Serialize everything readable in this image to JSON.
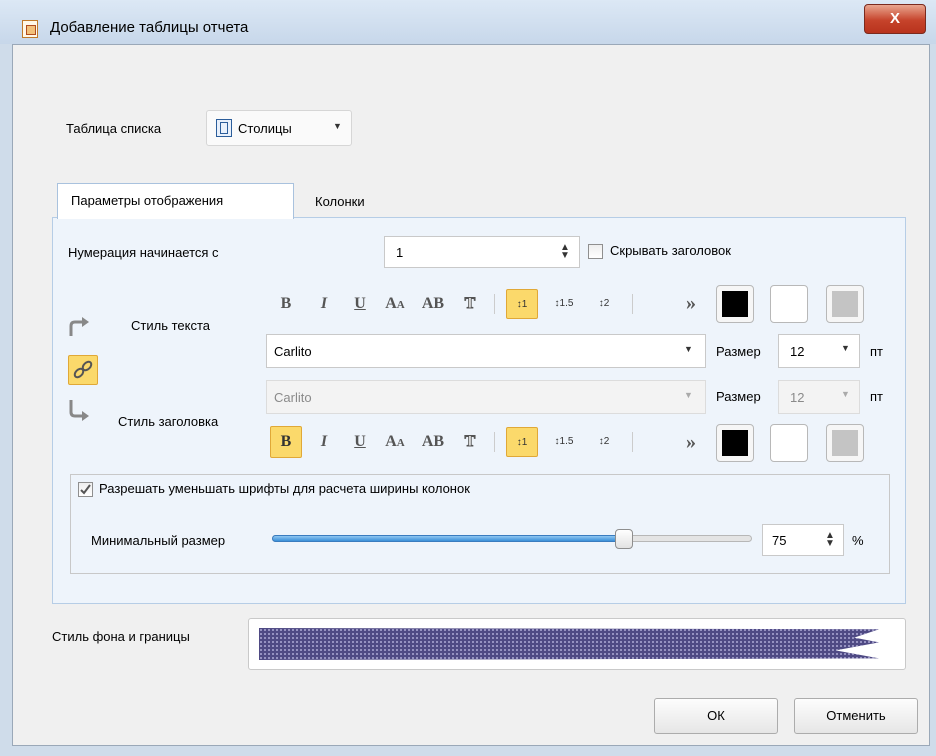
{
  "window": {
    "title": "Добавление таблицы отчета",
    "close_label": "X"
  },
  "list_table": {
    "label": "Таблица списка",
    "value": "Столицы"
  },
  "tabs": [
    {
      "label": "Параметры отображения",
      "active": true
    },
    {
      "label": "Колонки",
      "active": false
    }
  ],
  "numbering": {
    "label": "Нумерация начинается с",
    "value": "1"
  },
  "hide_header": {
    "label": "Скрывать заголовок",
    "checked": false
  },
  "text_style": {
    "label": "Стиль текста",
    "font": "Carlito",
    "size_label": "Размер",
    "size": "12",
    "unit": "пт",
    "bold_active": false,
    "line_spacing_active": "1"
  },
  "header_style": {
    "label": "Стиль заголовка",
    "font": "Carlito",
    "size_label": "Размер",
    "size": "12",
    "unit": "пт",
    "bold_active": true,
    "line_spacing_active": "1"
  },
  "toolbar": {
    "bold": "B",
    "italic": "I",
    "underline": "U",
    "smallcaps": "Aa",
    "caps": "AB",
    "outline": "T",
    "spacing1": "1",
    "spacing15": "1.5",
    "spacing2": "2",
    "more": "»"
  },
  "colors": {
    "text_color": "#000000",
    "background": "#ffffff",
    "border": "#c0c0c0",
    "accent": "#fbd96b"
  },
  "shrink_fonts": {
    "label": "Разрешать уменьшать шрифты для расчета ширины колонок",
    "checked": true
  },
  "min_size": {
    "label": "Минимальный размер",
    "value": "75",
    "unit": "%",
    "slider_fraction": 0.72
  },
  "background_style": {
    "label": "Стиль фона и границы"
  },
  "buttons": {
    "ok": "ОК",
    "cancel": "Отменить"
  }
}
